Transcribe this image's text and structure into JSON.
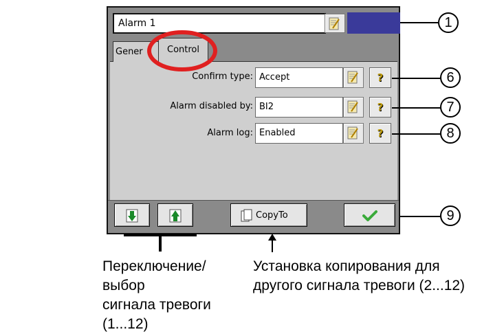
{
  "window": {
    "title_value": "Alarm 1"
  },
  "tabs": [
    {
      "label": "Gener",
      "active": false
    },
    {
      "label": "Control",
      "active": true
    }
  ],
  "form": {
    "confirm_type": {
      "label": "Confirm type:",
      "value": "Accept"
    },
    "alarm_disabled_by": {
      "label": "Alarm disabled by:",
      "value": "BI2"
    },
    "alarm_log": {
      "label": "Alarm log:",
      "value": "Enabled"
    }
  },
  "help_glyph": "?",
  "toolbar": {
    "copyto_label": "CopyTo"
  },
  "callouts": [
    "1",
    "6",
    "7",
    "8",
    "9"
  ],
  "captions": {
    "left": [
      "Переключение/выбор",
      "сигнала тревоги (1...12)"
    ],
    "right": [
      "Установка копирования для",
      "другого сигнала тревоги (2...12)"
    ]
  },
  "colors": {
    "panel_bg": "#8a8a8a",
    "title_bar": "#3a3a9a",
    "highlight_ring": "#e02020",
    "arrow_green": "#1a8a2a",
    "check_green": "#3aaa3a"
  },
  "icons": [
    "edit-icon",
    "help-icon",
    "arrow-down-icon",
    "arrow-up-icon",
    "copy-icon",
    "checkmark-icon"
  ]
}
